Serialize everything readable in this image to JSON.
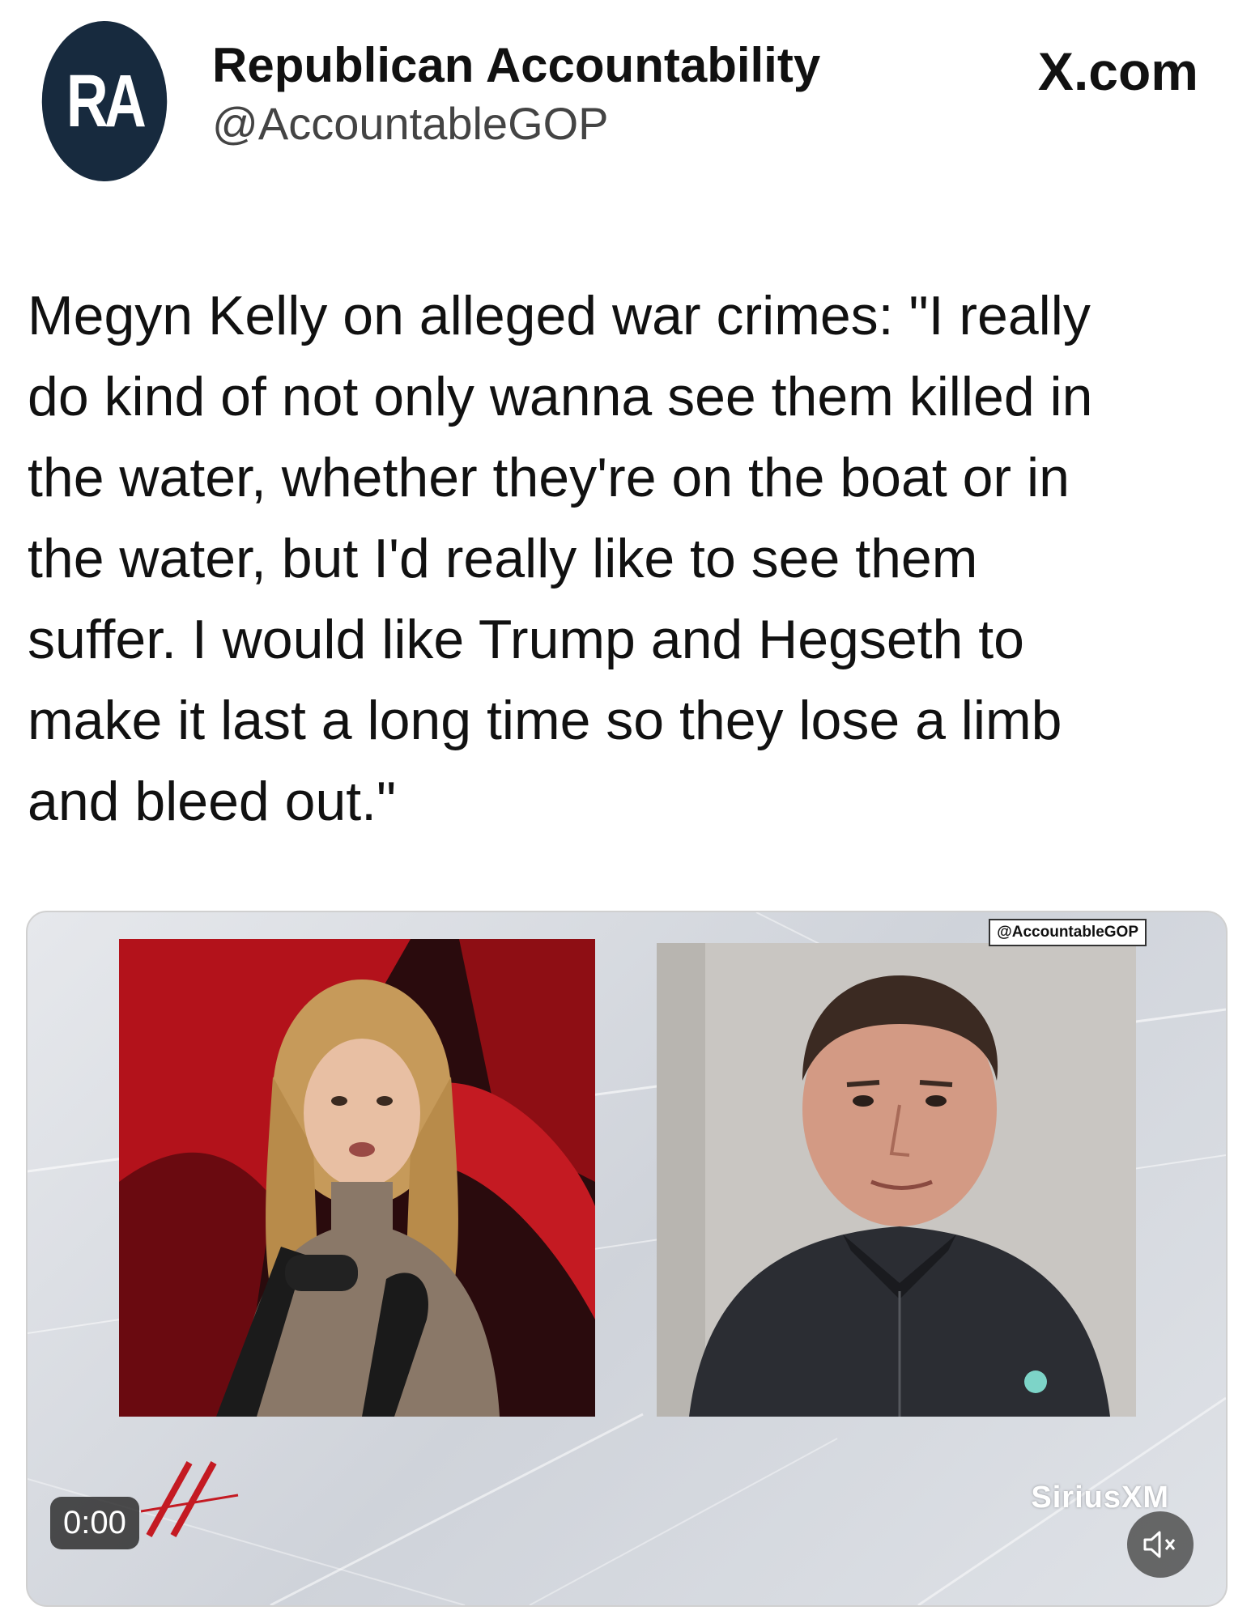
{
  "account": {
    "avatar_initials": "RA",
    "display_name": "Republican Accountability",
    "handle": "@AccountableGOP"
  },
  "source_label": "X.com",
  "tweet": {
    "text": "Megyn Kelly on alleged war crimes: \"I really\ndo kind of not only wanna see them killed in\nthe water, whether they're on the boat or in\nthe water, but I'd really like to see them\nsuffer. I would like Trump and Hegseth to\nmake it last a long time so they lose a limb\nand bleed out.\""
  },
  "video": {
    "watermark": "@AccountableGOP",
    "timestamp": "0:00",
    "network_logo": "SiriusXM",
    "mute_icon": "speaker-muted-icon"
  },
  "colors": {
    "avatar_bg": "#172a3e",
    "left_panel_red": "#b3121b",
    "right_panel_bg": "#c9c6c2"
  }
}
